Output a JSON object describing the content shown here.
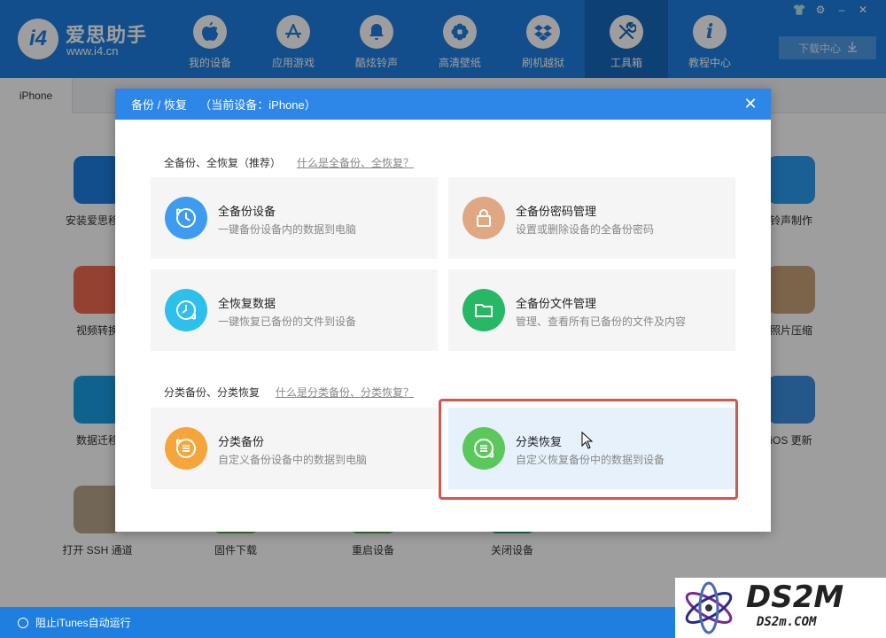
{
  "app": {
    "name": "爱思助手",
    "url": "www.i4.cn",
    "logo_text": "i4"
  },
  "nav": [
    {
      "label": "我的设备",
      "icon": "apple-icon",
      "glyph": ""
    },
    {
      "label": "应用游戏",
      "icon": "app-store-icon",
      "glyph": "A"
    },
    {
      "label": "酷炫铃声",
      "icon": "bell-icon",
      "glyph": "🔔"
    },
    {
      "label": "高清壁纸",
      "icon": "flower-icon",
      "glyph": "✿"
    },
    {
      "label": "刷机越狱",
      "icon": "dropbox-icon",
      "glyph": "◈"
    },
    {
      "label": "工具箱",
      "icon": "tools-icon",
      "glyph": "✕"
    },
    {
      "label": "教程中心",
      "icon": "info-icon",
      "glyph": "i"
    }
  ],
  "nav_active_index": 5,
  "window_controls": [
    "👕",
    "⚙",
    "–",
    "✕"
  ],
  "download_center": "下载中心",
  "device_tab": "iPhone",
  "tools": [
    {
      "label": "安装爱思移动",
      "color": "#1e7fe0"
    },
    {
      "label": "铃声制作",
      "color": "#2c9cf0"
    },
    {
      "label": "视频转换",
      "color": "#f06a4f"
    },
    {
      "label": "照片压缩",
      "color": "#c8a27a"
    },
    {
      "label": "数据迁移",
      "color": "#1a9fe6"
    },
    {
      "label": "iOS 更新",
      "color": "#3a8fe0"
    },
    {
      "label": "打开 SSH 通道",
      "color": "#b8a58c"
    },
    {
      "label": "固件下载",
      "color": "#5cb85c"
    },
    {
      "label": "重启设备",
      "color": "#5cb85c"
    },
    {
      "label": "关闭设备",
      "color": "#3aa97a"
    }
  ],
  "status": {
    "label": "阻止iTunes自动运行"
  },
  "dialog": {
    "title": "备份 / 恢复    （当前设备：iPhone）",
    "close": "✕",
    "section1": {
      "title": "全备份、全恢复（推荐）",
      "link": "什么是全备份、全恢复？"
    },
    "section2": {
      "title": "分类备份、分类恢复",
      "link": "什么是分类备份、分类恢复？"
    },
    "cards": [
      {
        "title": "全备份设备",
        "desc": "一键备份设备内的数据到电脑",
        "icon": "backup-clock-icon",
        "color": "#3d9cf0"
      },
      {
        "title": "全备份密码管理",
        "desc": "设置或删除设备的全备份密码",
        "icon": "lock-icon",
        "color": "#e0a882"
      },
      {
        "title": "全恢复数据",
        "desc": "一键恢复已备份的文件到设备",
        "icon": "restore-clock-icon",
        "color": "#2cc0ea"
      },
      {
        "title": "全备份文件管理",
        "desc": "管理、查看所有已备份的文件及内容",
        "icon": "folder-icon",
        "color": "#27b866"
      },
      {
        "title": "分类备份",
        "desc": "自定义备份设备中的数据到电脑",
        "icon": "category-backup-icon",
        "color": "#f6a53a"
      },
      {
        "title": "分类恢复",
        "desc": "自定义恢复备份中的数据到设备",
        "icon": "category-restore-icon",
        "color": "#5cc85c"
      }
    ]
  },
  "watermark": {
    "main": "DS2M",
    "sub": "DS2m.COM"
  }
}
